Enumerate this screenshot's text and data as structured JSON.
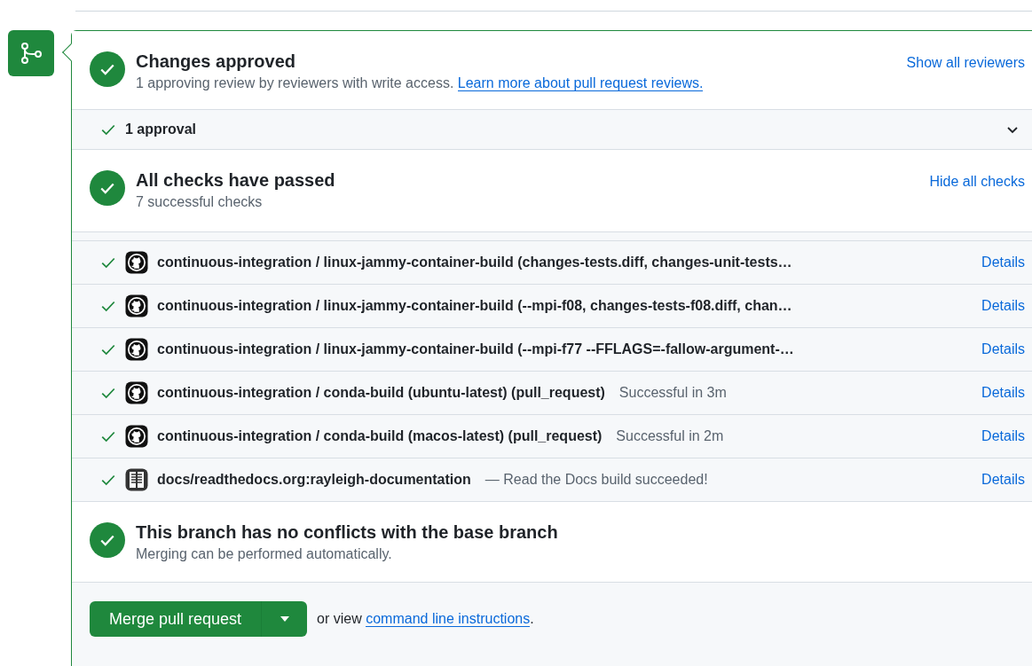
{
  "review": {
    "title": "Changes approved",
    "subtitle": "1 approving review by reviewers with write access.",
    "link": "Learn more about pull request reviews.",
    "action": "Show all reviewers"
  },
  "approvals": {
    "label": "1 approval",
    "expanded": false
  },
  "checks_summary": {
    "title": "All checks have passed",
    "subtitle": "7 successful checks",
    "action": "Hide all checks"
  },
  "checks": [
    {
      "kind": "github",
      "name": "continuous-integration / linux-jammy-container-build (changes-tests.diff, changes-unit-tests…",
      "link": "Details"
    },
    {
      "kind": "github",
      "name": "continuous-integration / linux-jammy-container-build (--mpi-f08, changes-tests-f08.diff, chan…",
      "link": "Details"
    },
    {
      "kind": "github",
      "name": "continuous-integration / linux-jammy-container-build (--mpi-f77 --FFLAGS=-fallow-argument-…",
      "link": "Details"
    },
    {
      "kind": "github",
      "name": "continuous-integration / conda-build (ubuntu-latest) (pull_request)",
      "description": "Successful in 3m",
      "link": "Details"
    },
    {
      "kind": "github",
      "name": "continuous-integration / conda-build (macos-latest) (pull_request)",
      "description": "Successful in 2m",
      "link": "Details"
    },
    {
      "kind": "docs",
      "name": "docs/readthedocs.org:rayleigh-documentation",
      "description": "— Read the Docs build succeeded!",
      "link": "Details"
    }
  ],
  "conflicts": {
    "title": "This branch has no conflicts with the base branch",
    "subtitle": "Merging can be performed automatically."
  },
  "merge": {
    "button": "Merge pull request",
    "prefix": "or view",
    "link": "command line instructions",
    "suffix": "."
  }
}
